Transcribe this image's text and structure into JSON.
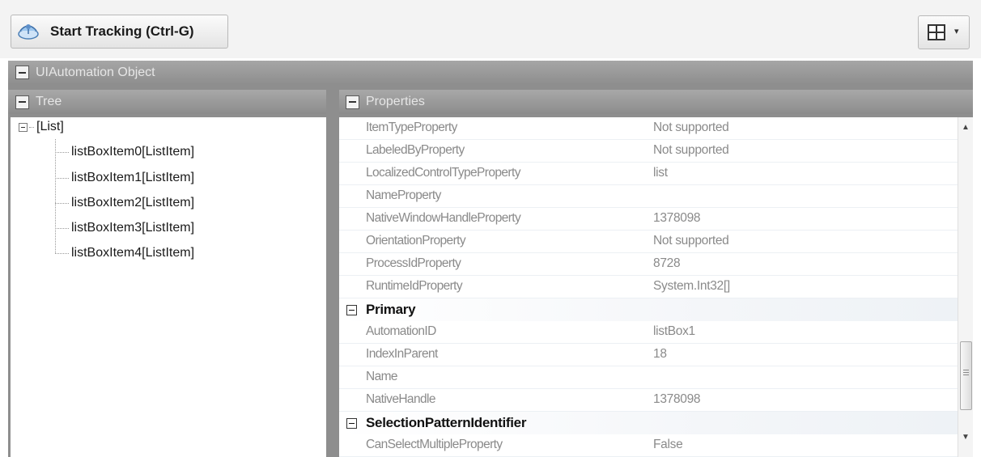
{
  "toolbar": {
    "start_tracking_label": "Start Tracking (Ctrl-G)",
    "start_tracking_icon": "satellite-dish-icon",
    "layout_icon": "grid-layout-icon"
  },
  "object_panel": {
    "title": "UIAutomation Object"
  },
  "tree_panel": {
    "title": "Tree",
    "root_label": "[List]",
    "items": [
      "listBoxItem0[ListItem]",
      "listBoxItem1[ListItem]",
      "listBoxItem2[ListItem]",
      "listBoxItem3[ListItem]",
      "listBoxItem4[ListItem]"
    ]
  },
  "properties_panel": {
    "title": "Properties",
    "rows": [
      {
        "name": "ItemTypeProperty",
        "value": "Not supported"
      },
      {
        "name": "LabeledByProperty",
        "value": "Not supported"
      },
      {
        "name": "LocalizedControlTypeProperty",
        "value": "list"
      },
      {
        "name": "NameProperty",
        "value": ""
      },
      {
        "name": "NativeWindowHandleProperty",
        "value": "1378098"
      },
      {
        "name": "OrientationProperty",
        "value": "Not supported"
      },
      {
        "name": "ProcessIdProperty",
        "value": "8728"
      },
      {
        "name": "RuntimeIdProperty",
        "value": "System.Int32[]"
      }
    ],
    "groups": [
      {
        "name": "Primary",
        "rows": [
          {
            "name": "AutomationID",
            "value": "listBox1"
          },
          {
            "name": "IndexInParent",
            "value": "18"
          },
          {
            "name": "Name",
            "value": ""
          },
          {
            "name": "NativeHandle",
            "value": "1378098"
          }
        ]
      },
      {
        "name": "SelectionPatternIdentifier",
        "rows": [
          {
            "name": "CanSelectMultipleProperty",
            "value": "False"
          }
        ]
      }
    ]
  }
}
